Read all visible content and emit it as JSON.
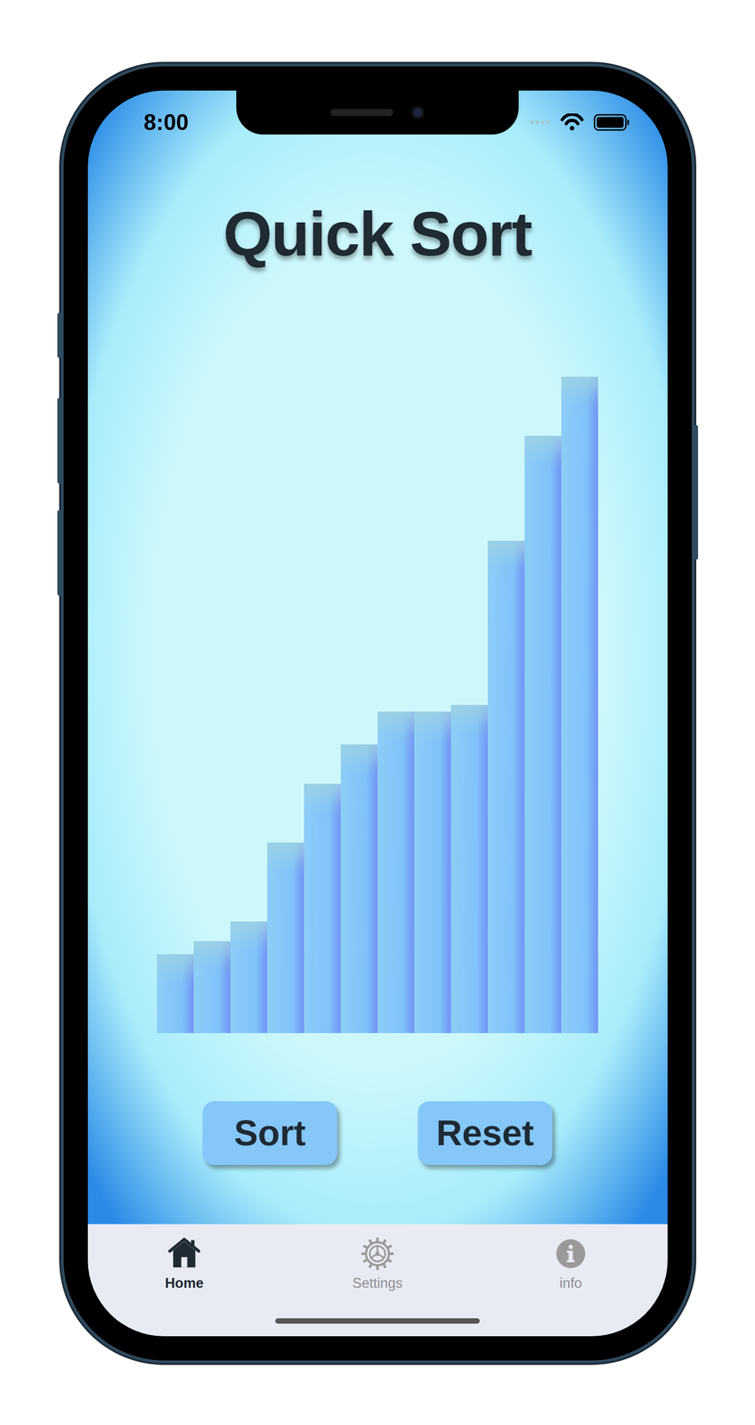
{
  "status_bar": {
    "time": "8:00"
  },
  "title": "Quick Sort",
  "chart": {
    "series": [
      {
        "values": [
          12,
          14,
          17,
          29,
          38,
          44,
          49,
          49,
          50,
          75,
          91,
          100
        ]
      }
    ]
  },
  "buttons": [
    "Sort",
    "Reset"
  ],
  "tab_bar": [
    {
      "label": "Home",
      "selected": true,
      "kind": "home"
    },
    {
      "label": "Settings",
      "selected": false,
      "kind": "settings"
    },
    {
      "label": "info",
      "selected": false,
      "kind": "info"
    }
  ]
}
